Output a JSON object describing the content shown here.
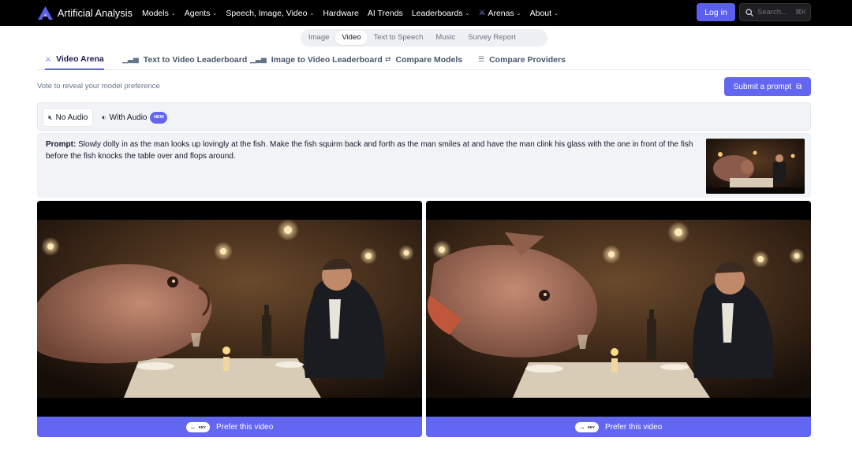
{
  "brand": {
    "name": "Artificial Analysis",
    "accent": "#5b5ff0"
  },
  "nav": {
    "items": [
      {
        "label": "Models",
        "dropdown": true
      },
      {
        "label": "Agents",
        "dropdown": true
      },
      {
        "label": "Speech, Image, Video",
        "dropdown": true
      },
      {
        "label": "Hardware",
        "dropdown": false
      },
      {
        "label": "AI Trends",
        "dropdown": false
      },
      {
        "label": "Leaderboards",
        "dropdown": true
      },
      {
        "label": "Arenas",
        "dropdown": true,
        "icon": "arena-icon"
      },
      {
        "label": "About",
        "dropdown": true
      }
    ],
    "login_label": "Log in",
    "search_placeholder": "Search...",
    "search_shortcut": "⌘K"
  },
  "media_tabs": [
    "Image",
    "Video",
    "Text to Speech",
    "Music",
    "Survey Report"
  ],
  "media_tab_active": "Video",
  "subtabs": [
    {
      "label": "Video Arena",
      "icon": "arena-icon",
      "active": true
    },
    {
      "label": "Text to Video Leaderboard",
      "icon": "bar-chart-icon",
      "active": false
    },
    {
      "label": "Image to Video Leaderboard",
      "icon": "bar-chart-icon",
      "active": false
    },
    {
      "label": "Compare Models",
      "icon": "compare-icon",
      "active": false
    },
    {
      "label": "Compare Providers",
      "icon": "server-icon",
      "active": false
    }
  ],
  "main": {
    "vote_text": "Vote to reveal your model preference",
    "submit_label": "Submit a prompt"
  },
  "audio": {
    "no_audio_label": "No Audio",
    "with_audio_label": "With Audio",
    "new_badge": "NEW",
    "selected": "No Audio"
  },
  "prompt": {
    "label": "Prompt:",
    "text": "Slowly dolly in as the man looks up lovingly at the fish. Make the fish squirm back and forth as the man smiles at and have the man clink his glass with the one in front of the fish before the fish knocks the table over and flops around."
  },
  "videos": {
    "left": {
      "prefer_label": "Prefer this video",
      "key_arrow": "←",
      "key_label": "KEY"
    },
    "right": {
      "prefer_label": "Prefer this video",
      "key_arrow": "→",
      "key_label": "KEY"
    }
  }
}
